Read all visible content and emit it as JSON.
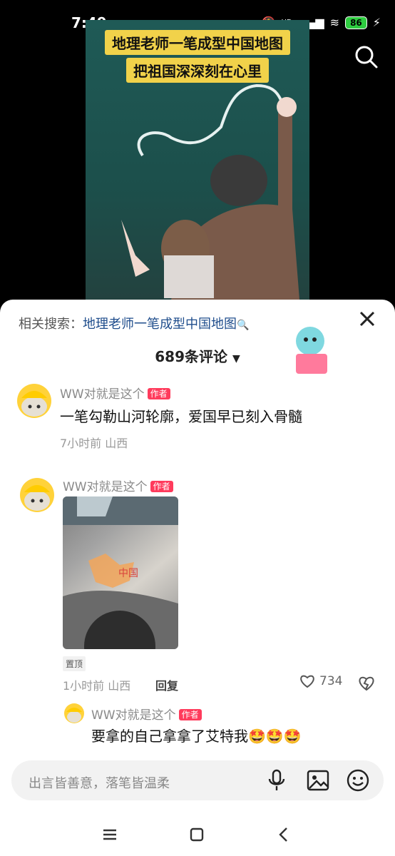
{
  "status": {
    "time": "7:49",
    "battery": "86",
    "hd": "HD"
  },
  "video": {
    "title_line1": "地理老师一笔成型中国地图",
    "title_line2": "把祖国深深刻在心里"
  },
  "sheet": {
    "related_label": "相关搜索：",
    "related_query": "地理老师一笔成型中国地图",
    "comment_count": "689条评论"
  },
  "comments": [
    {
      "username": "WW对就是这个",
      "badge": "作者",
      "text": "一笔勾勒山河轮廓，爱国早已刻入骨髓",
      "meta": "7小时前 山西"
    },
    {
      "username": "WW对就是这个",
      "badge": "作者",
      "pin": "置顶",
      "meta": "1小时前 山西",
      "reply_label": "回复",
      "likes": "734",
      "photo_text": "中国"
    }
  ],
  "reply": {
    "username": "WW对就是这个",
    "badge": "作者",
    "text": "要拿的自己拿拿了艾特我🤩🤩🤩"
  },
  "input": {
    "placeholder": "出言皆善意，落笔皆温柔"
  },
  "icons": {
    "search": "search-icon",
    "close": "close-icon",
    "mic": "mic-icon",
    "image": "image-icon",
    "emoji": "emoji-icon",
    "heart": "heart-icon",
    "dislike": "broken-heart-icon",
    "menu": "menu-icon",
    "home": "home-icon",
    "back": "back-icon"
  },
  "colors": {
    "accent": "#ff3b5c",
    "link": "#1f4d8c",
    "title_bg": "#f1d24a"
  }
}
